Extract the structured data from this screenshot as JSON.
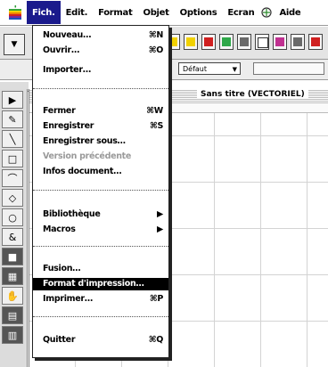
{
  "menubar": {
    "apple_icon": "apple-logo-icon",
    "items": [
      {
        "label": "Fich.",
        "active": true
      },
      {
        "label": "Edit."
      },
      {
        "label": "Format"
      },
      {
        "label": "Objet"
      },
      {
        "label": "Options"
      },
      {
        "label": "Ecran"
      },
      {
        "label": "Aide",
        "icon": "help-icon"
      }
    ]
  },
  "toolbar": {
    "style_select_value": "Défaut"
  },
  "document": {
    "title": "Sans titre (VECTORIEL)"
  },
  "file_menu": {
    "items": [
      {
        "label": "Nouveau…",
        "shortcut": "⌘N"
      },
      {
        "label": "Ouvrir…",
        "shortcut": "⌘O"
      },
      {
        "label": "Importer…",
        "shortcut": ""
      },
      {
        "label": "Fermer",
        "shortcut": "⌘W"
      },
      {
        "label": "Enregistrer",
        "shortcut": "⌘S"
      },
      {
        "label": "Enregistrer sous…",
        "shortcut": ""
      },
      {
        "label": "Version précédente",
        "shortcut": "",
        "disabled": true
      },
      {
        "label": "Infos document…",
        "shortcut": ""
      },
      {
        "label": "Bibliothèque",
        "shortcut": "▶"
      },
      {
        "label": "Macros",
        "shortcut": "▶"
      },
      {
        "label": "Fusion…",
        "shortcut": ""
      },
      {
        "label": "Format d'impression…",
        "shortcut": "",
        "highlighted": true
      },
      {
        "label": "Imprimer…",
        "shortcut": "⌘P"
      },
      {
        "label": "Quitter",
        "shortcut": "⌘Q"
      }
    ]
  },
  "colors": {
    "menubar_active": "#1a1a8c",
    "menu_highlight": "#000000"
  }
}
